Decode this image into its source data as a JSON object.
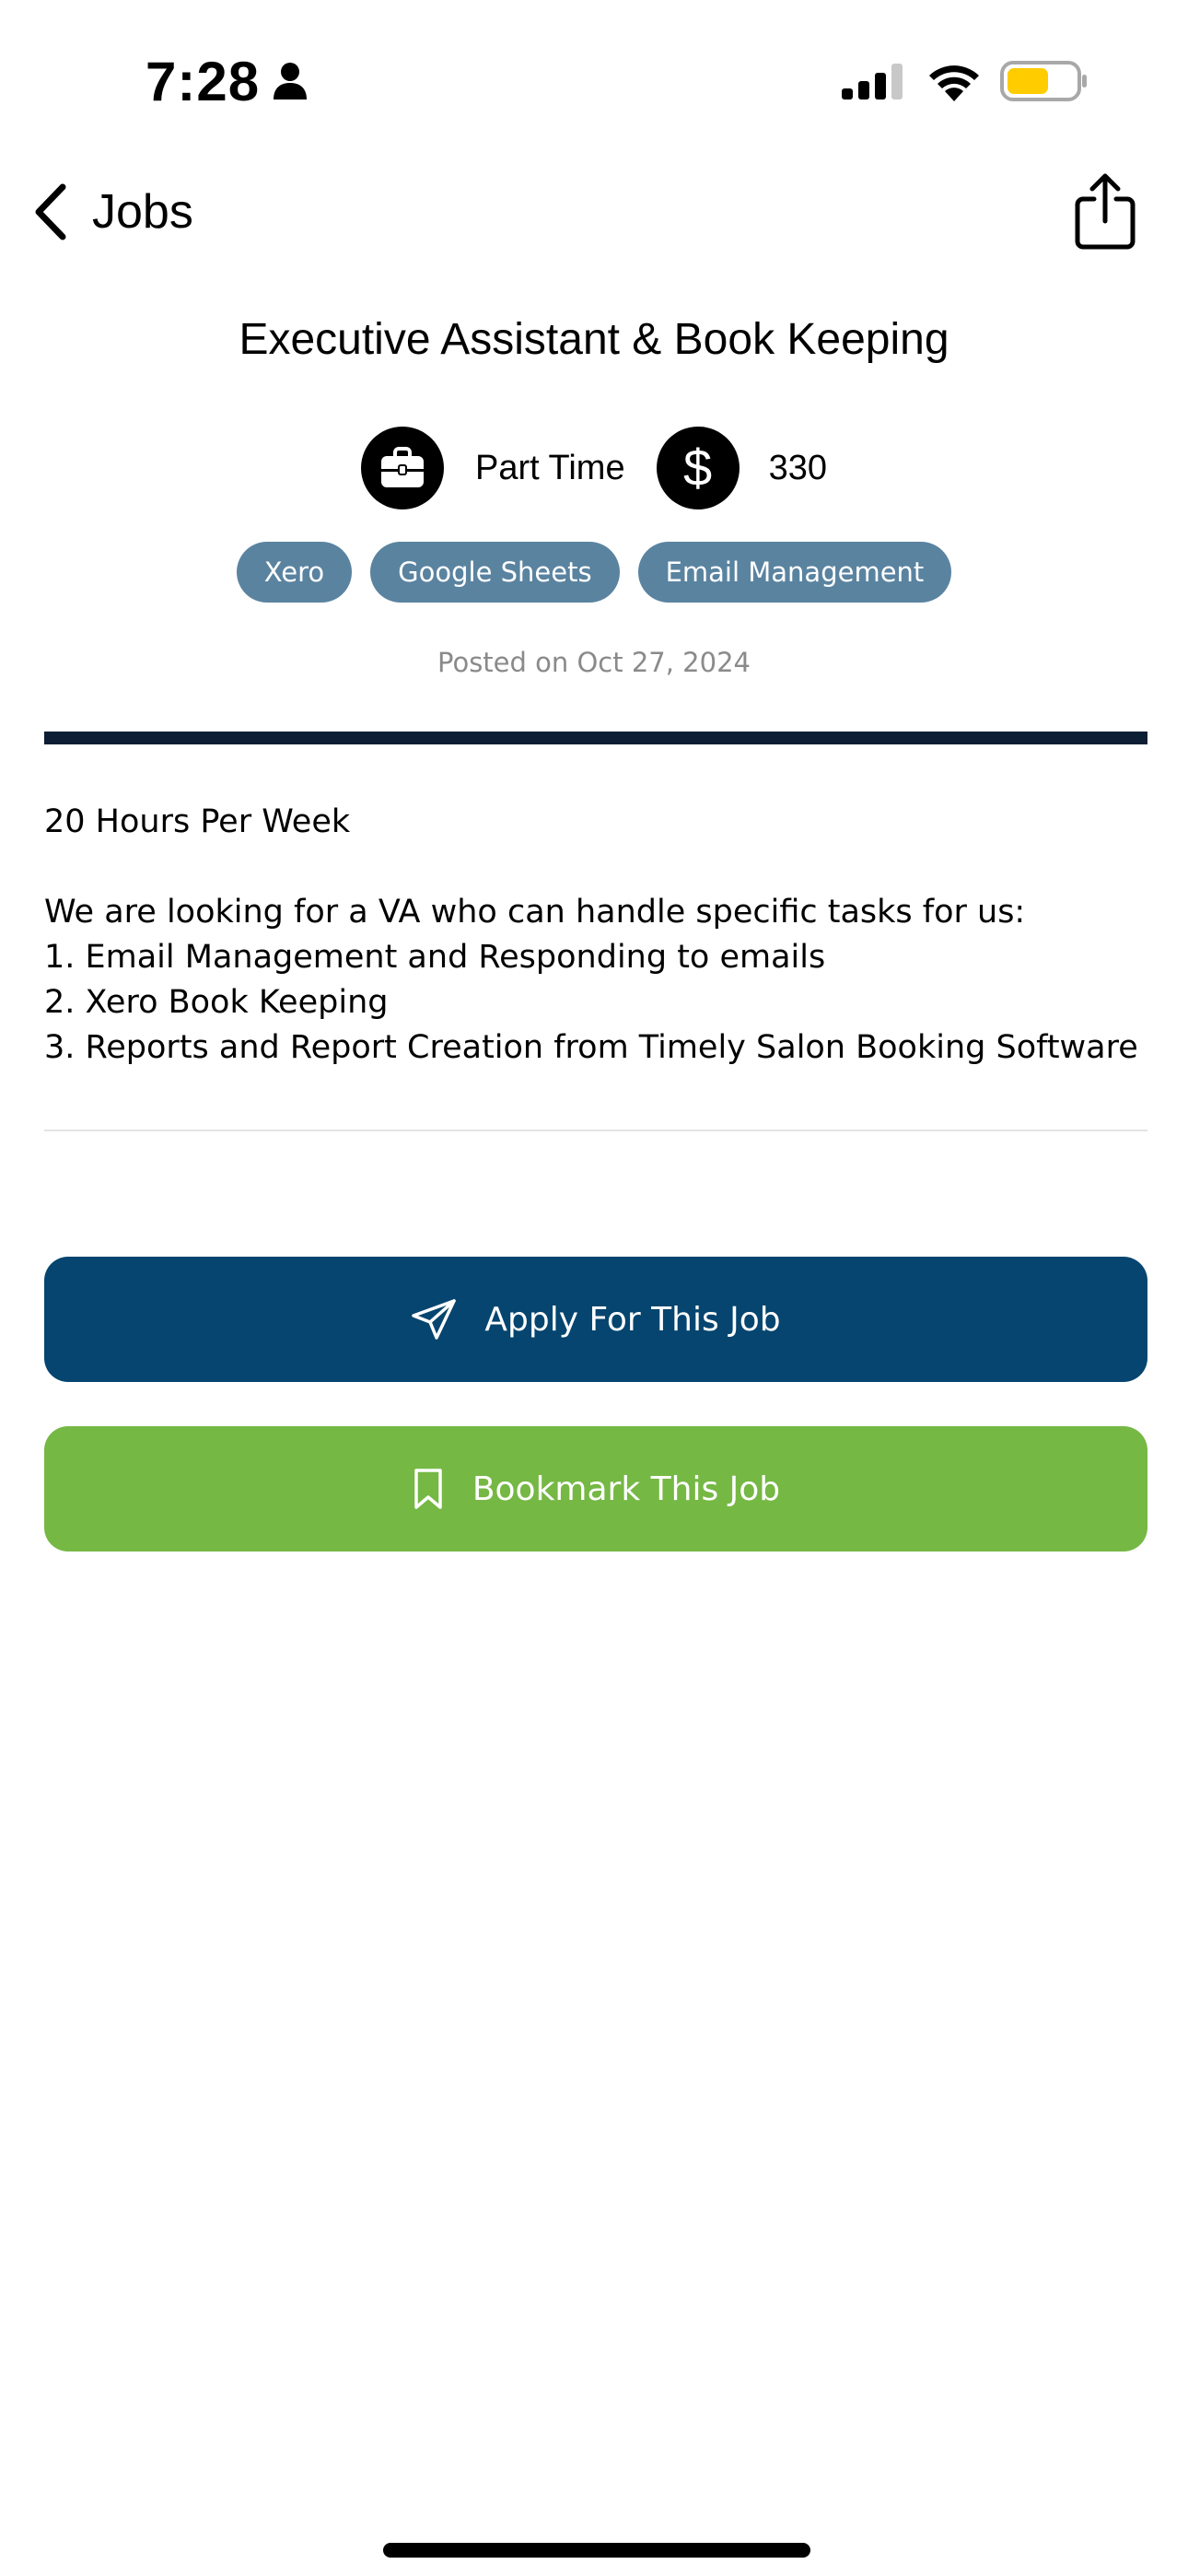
{
  "status_bar": {
    "time": "7:28",
    "icons": [
      "person-icon",
      "cellular-signal-icon",
      "wifi-icon",
      "battery-icon"
    ],
    "battery_color": "#ffcc00"
  },
  "nav": {
    "back_label": "Jobs",
    "back_icon": "chevron-left-icon",
    "share_icon": "share-icon"
  },
  "job": {
    "title": "Executive Assistant & Book Keeping",
    "employment_type": "Part Time",
    "pay": "330",
    "tags": [
      "Xero",
      "Google Sheets",
      "Email Management"
    ],
    "posted": "Posted on Oct 27, 2024",
    "description": {
      "line1": "20 Hours Per Week",
      "line2": "We are looking for a VA who can handle specific tasks for us:",
      "line3": "1. Email Management and Responding to emails",
      "line4": "2. Xero Book Keeping",
      "line5": "3. Reports and Report Creation from Timely Salon Booking Software"
    }
  },
  "actions": {
    "apply_label": "Apply For This Job",
    "bookmark_label": "Bookmark This Job",
    "apply_color": "#05456f",
    "bookmark_color": "#75b844"
  },
  "colors": {
    "tag_background": "#5a83a0",
    "divider": "#0b1e33",
    "posted_text": "#8a8a8a"
  }
}
